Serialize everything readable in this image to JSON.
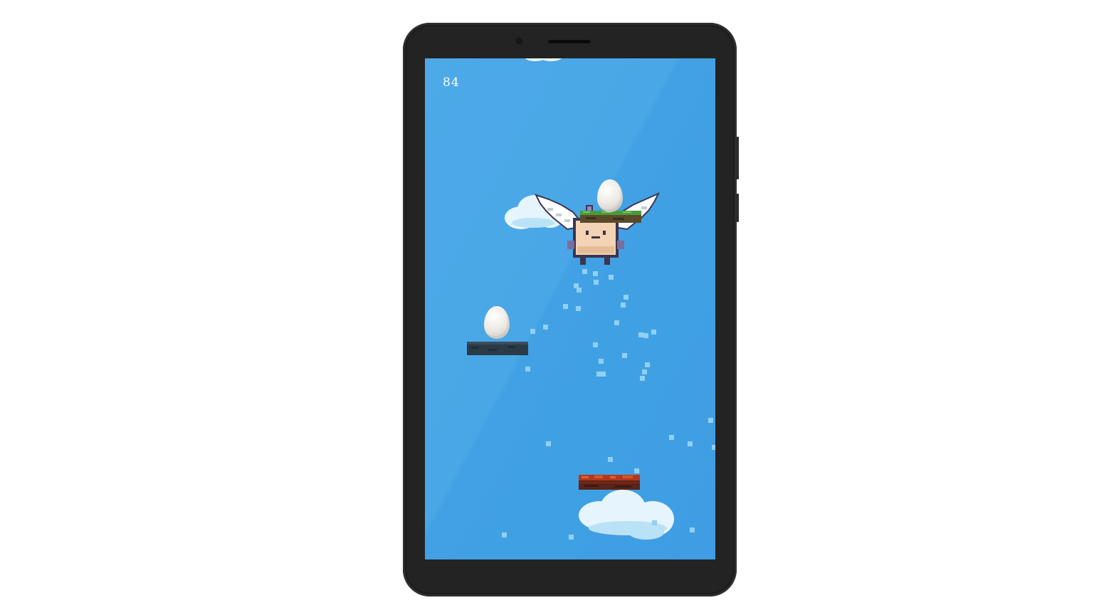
{
  "game": {
    "score": "84"
  },
  "colors": {
    "sky": "#45a4e5",
    "device_body": "#232323",
    "score_text": "#ffffff",
    "sparkle": "#8fd0f3",
    "cloud": "#e6f5fd",
    "platform_dark": "#2b3a47",
    "platform_grass": "#4a9a3c",
    "platform_lava": "#9a2e1a",
    "egg": "#efece7",
    "creature_body": "#f3d3b3"
  },
  "icons": {
    "character": "winged-creature-icon",
    "egg": "egg-icon",
    "cloud": "cloud-icon"
  }
}
